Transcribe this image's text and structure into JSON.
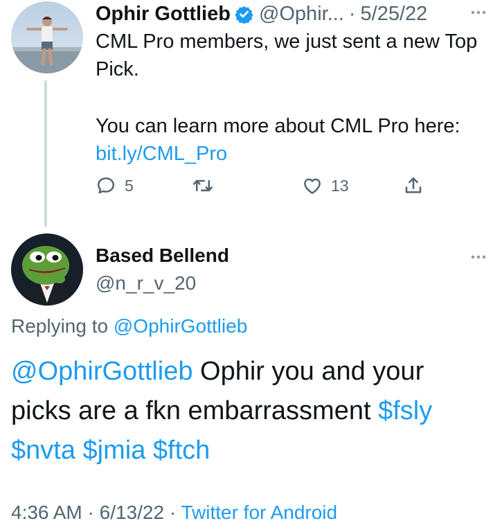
{
  "parent_tweet": {
    "display_name": "Ophir Gottlieb",
    "handle": "@Ophir...",
    "separator": "·",
    "date": "5/25/22",
    "text_line1": "CML Pro members, we just sent a new Top Pick.",
    "text_line2": "You can learn more about CML Pro here:",
    "link": "bit.ly/CML_Pro",
    "reply_count": "5",
    "like_count": "13"
  },
  "reply_tweet": {
    "display_name": "Based Bellend",
    "handle": "@n_r_v_20",
    "replying_prefix": "Replying to",
    "replying_handle": "@OphirGottlieb",
    "mention": "@OphirGottlieb",
    "text": "Ophir you and your picks are a fkn embarrassment",
    "tickers": [
      "$fsly",
      "$nvta",
      "$jmia",
      "$ftch"
    ],
    "time": "4:36 AM",
    "date": "6/13/22",
    "separator": "·",
    "source": "Twitter for Android"
  },
  "colors": {
    "link": "#1d9bf0",
    "text": "#0f1419",
    "muted": "#536471",
    "thread_line": "#cfd9de",
    "verified": "#1d9bf0"
  },
  "icons": {
    "reply": "reply-icon",
    "retweet": "retweet-icon",
    "like": "heart-icon",
    "share": "share-icon",
    "more": "more-icon",
    "verified": "verified-badge-icon"
  }
}
